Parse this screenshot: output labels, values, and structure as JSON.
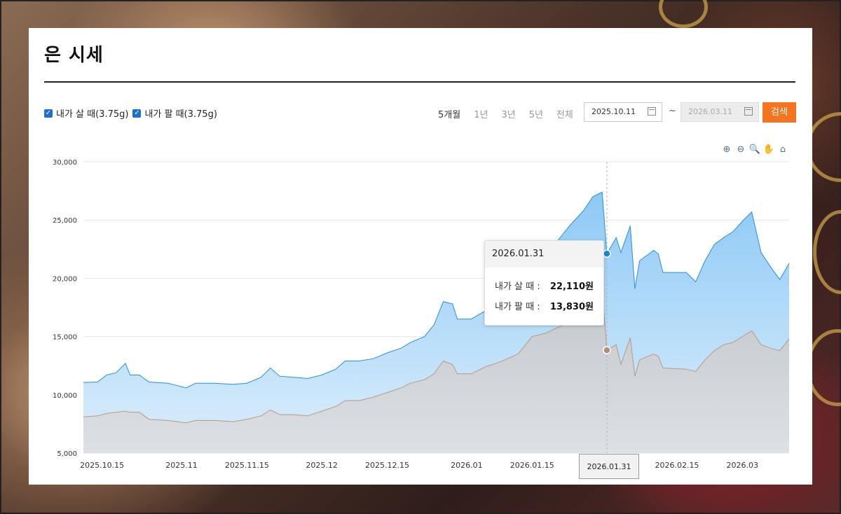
{
  "page": {
    "title": "은 시세"
  },
  "legend": {
    "buy_label": "내가 살 때(3.75g)",
    "sell_label": "내가 팔 때(3.75g)"
  },
  "periods": [
    "5개월",
    "1년",
    "3년",
    "5년",
    "전체"
  ],
  "active_period": "5개월",
  "date_from": "2025.10.11",
  "date_separator": "~",
  "date_to": "2026.03.11",
  "search_label": "검색",
  "toolbar_icons": [
    "zoom-in-icon",
    "zoom-out-icon",
    "zoom-select-icon",
    "pan-hand-icon",
    "home-reset-icon"
  ],
  "tooltip": {
    "date": "2026.01.31",
    "buy_label": "내가 살 때 :",
    "buy_value": "22,110원",
    "sell_label": "내가 팔 때 :",
    "sell_value": "13,830원"
  },
  "colors": {
    "buy_line": "#2a8fd6",
    "sell_line": "#b99882",
    "search_button": "#f5741f"
  },
  "chart_data": {
    "type": "area",
    "ylim": [
      5000,
      30000
    ],
    "yticks": [
      5000,
      10000,
      15000,
      20000,
      25000,
      30000
    ],
    "ytick_labels": [
      "5,000",
      "10,000",
      "15,000",
      "20,000",
      "25,000",
      "30,000"
    ],
    "xlim": [
      "2025-10-11",
      "2026-03-11"
    ],
    "xticks": [
      "2025-10-15",
      "2025-11-01",
      "2025-11-15",
      "2025-12-01",
      "2025-12-15",
      "2026-01-01",
      "2026-01-15",
      "2026-01-31",
      "2026-02-15",
      "2026-03-01"
    ],
    "xtick_labels": [
      "2025.10.15",
      "2025.11",
      "2025.11.15",
      "2025.12",
      "2025.12.15",
      "2026.01",
      "2026.01.15",
      "2026.01.31",
      "2026.02.15",
      "2026.03"
    ],
    "grid": true,
    "crosshair_date": "2026-01-31",
    "series": [
      {
        "name": "내가 살 때(3.75g)",
        "points": [
          [
            "2025-10-11",
            11050
          ],
          [
            "2025-10-14",
            11100
          ],
          [
            "2025-10-16",
            11700
          ],
          [
            "2025-10-18",
            11900
          ],
          [
            "2025-10-20",
            12700
          ],
          [
            "2025-10-21",
            11700
          ],
          [
            "2025-10-23",
            11700
          ],
          [
            "2025-10-25",
            11100
          ],
          [
            "2025-10-29",
            11000
          ],
          [
            "2025-11-02",
            10600
          ],
          [
            "2025-11-04",
            11000
          ],
          [
            "2025-11-08",
            11000
          ],
          [
            "2025-11-12",
            10900
          ],
          [
            "2025-11-15",
            11000
          ],
          [
            "2025-11-18",
            11500
          ],
          [
            "2025-11-20",
            12300
          ],
          [
            "2025-11-22",
            11600
          ],
          [
            "2025-11-25",
            11500
          ],
          [
            "2025-11-28",
            11400
          ],
          [
            "2025-12-01",
            11700
          ],
          [
            "2025-12-04",
            12200
          ],
          [
            "2025-12-06",
            12900
          ],
          [
            "2025-12-09",
            12900
          ],
          [
            "2025-12-12",
            13100
          ],
          [
            "2025-12-15",
            13600
          ],
          [
            "2025-12-18",
            14000
          ],
          [
            "2025-12-20",
            14500
          ],
          [
            "2025-12-23",
            15000
          ],
          [
            "2025-12-25",
            16000
          ],
          [
            "2025-12-27",
            18000
          ],
          [
            "2025-12-29",
            17800
          ],
          [
            "2025-12-30",
            16500
          ],
          [
            "2026-01-02",
            16500
          ],
          [
            "2026-01-05",
            17200
          ],
          [
            "2026-01-08",
            17800
          ],
          [
            "2026-01-12",
            19000
          ],
          [
            "2026-01-15",
            20500
          ],
          [
            "2026-01-18",
            21600
          ],
          [
            "2026-01-20",
            23000
          ],
          [
            "2026-01-23",
            24500
          ],
          [
            "2026-01-26",
            25800
          ],
          [
            "2026-01-28",
            27000
          ],
          [
            "2026-01-30",
            27400
          ],
          [
            "2026-01-31",
            22110
          ],
          [
            "2026-02-02",
            23500
          ],
          [
            "2026-02-03",
            22200
          ],
          [
            "2026-02-05",
            24500
          ],
          [
            "2026-02-06",
            19100
          ],
          [
            "2026-02-07",
            21500
          ],
          [
            "2026-02-10",
            22400
          ],
          [
            "2026-02-11",
            22100
          ],
          [
            "2026-02-12",
            20500
          ],
          [
            "2026-02-17",
            20500
          ],
          [
            "2026-02-19",
            19700
          ],
          [
            "2026-02-21",
            21500
          ],
          [
            "2026-02-23",
            22900
          ],
          [
            "2026-02-25",
            23500
          ],
          [
            "2026-02-27",
            24000
          ],
          [
            "2026-03-01",
            24900
          ],
          [
            "2026-03-03",
            25700
          ],
          [
            "2026-03-05",
            22200
          ],
          [
            "2026-03-07",
            21000
          ],
          [
            "2026-03-09",
            19900
          ],
          [
            "2026-03-11",
            21300
          ]
        ]
      },
      {
        "name": "내가 팔 때(3.75g)",
        "points": [
          [
            "2025-10-11",
            8100
          ],
          [
            "2025-10-14",
            8200
          ],
          [
            "2025-10-16",
            8400
          ],
          [
            "2025-10-18",
            8500
          ],
          [
            "2025-10-20",
            8600
          ],
          [
            "2025-10-21",
            8500
          ],
          [
            "2025-10-23",
            8500
          ],
          [
            "2025-10-25",
            7900
          ],
          [
            "2025-10-29",
            7800
          ],
          [
            "2025-11-02",
            7600
          ],
          [
            "2025-11-04",
            7800
          ],
          [
            "2025-11-08",
            7800
          ],
          [
            "2025-11-12",
            7700
          ],
          [
            "2025-11-15",
            7900
          ],
          [
            "2025-11-18",
            8200
          ],
          [
            "2025-11-20",
            8700
          ],
          [
            "2025-11-22",
            8300
          ],
          [
            "2025-11-25",
            8300
          ],
          [
            "2025-11-28",
            8200
          ],
          [
            "2025-12-01",
            8600
          ],
          [
            "2025-12-04",
            9000
          ],
          [
            "2025-12-06",
            9500
          ],
          [
            "2025-12-09",
            9500
          ],
          [
            "2025-12-12",
            9800
          ],
          [
            "2025-12-15",
            10200
          ],
          [
            "2025-12-18",
            10600
          ],
          [
            "2025-12-20",
            11000
          ],
          [
            "2025-12-23",
            11300
          ],
          [
            "2025-12-25",
            11800
          ],
          [
            "2025-12-27",
            12900
          ],
          [
            "2025-12-29",
            12600
          ],
          [
            "2025-12-30",
            11800
          ],
          [
            "2026-01-02",
            11800
          ],
          [
            "2026-01-05",
            12400
          ],
          [
            "2026-01-08",
            12800
          ],
          [
            "2026-01-12",
            13500
          ],
          [
            "2026-01-15",
            15000
          ],
          [
            "2026-01-18",
            15300
          ],
          [
            "2026-01-20",
            15700
          ],
          [
            "2026-01-23",
            16200
          ],
          [
            "2026-01-26",
            17000
          ],
          [
            "2026-01-28",
            18500
          ],
          [
            "2026-01-30",
            19000
          ],
          [
            "2026-01-31",
            13830
          ],
          [
            "2026-02-02",
            14300
          ],
          [
            "2026-02-03",
            12600
          ],
          [
            "2026-02-05",
            14900
          ],
          [
            "2026-02-06",
            11600
          ],
          [
            "2026-02-07",
            13000
          ],
          [
            "2026-02-10",
            13500
          ],
          [
            "2026-02-11",
            13300
          ],
          [
            "2026-02-12",
            12300
          ],
          [
            "2026-02-17",
            12200
          ],
          [
            "2026-02-19",
            12000
          ],
          [
            "2026-02-21",
            13000
          ],
          [
            "2026-02-23",
            13800
          ],
          [
            "2026-02-25",
            14300
          ],
          [
            "2026-02-27",
            14500
          ],
          [
            "2026-03-01",
            15000
          ],
          [
            "2026-03-03",
            15500
          ],
          [
            "2026-03-05",
            14300
          ],
          [
            "2026-03-07",
            14000
          ],
          [
            "2026-03-09",
            13800
          ],
          [
            "2026-03-11",
            14800
          ]
        ]
      }
    ]
  }
}
